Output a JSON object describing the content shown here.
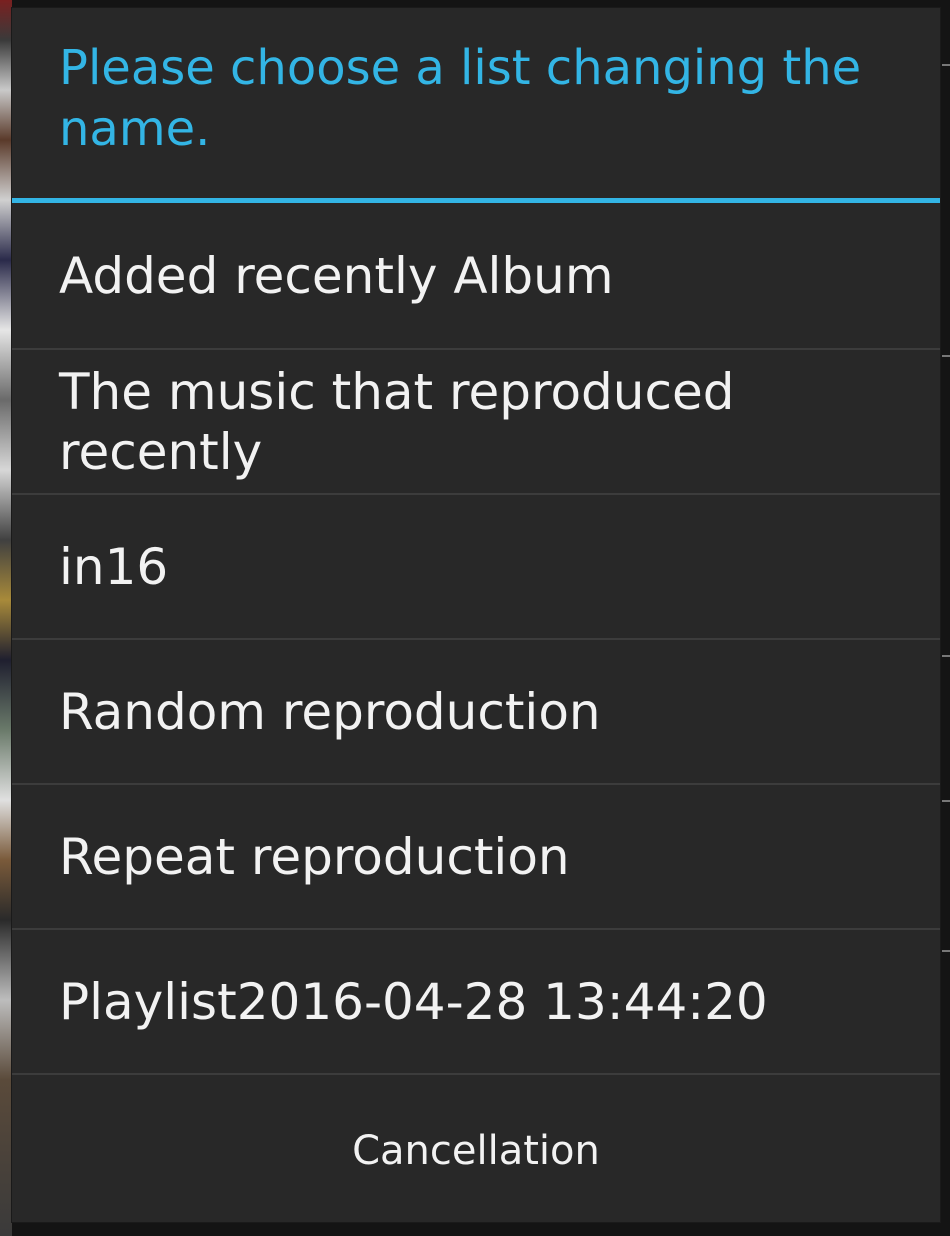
{
  "dialog": {
    "title": "Please choose a list changing the name.",
    "items": [
      {
        "label": "Added recently Album"
      },
      {
        "label": "The music that reproduced recently"
      },
      {
        "label": "in16"
      },
      {
        "label": "Random reproduction"
      },
      {
        "label": "Repeat reproduction"
      },
      {
        "label": "Playlist2016-04-28 13:44:20"
      }
    ],
    "cancel_label": "Cancellation"
  },
  "colors": {
    "accent": "#33b5e5",
    "dialog_background": "#282828",
    "divider": "#3c3c3c",
    "text": "#f2f2f2"
  }
}
